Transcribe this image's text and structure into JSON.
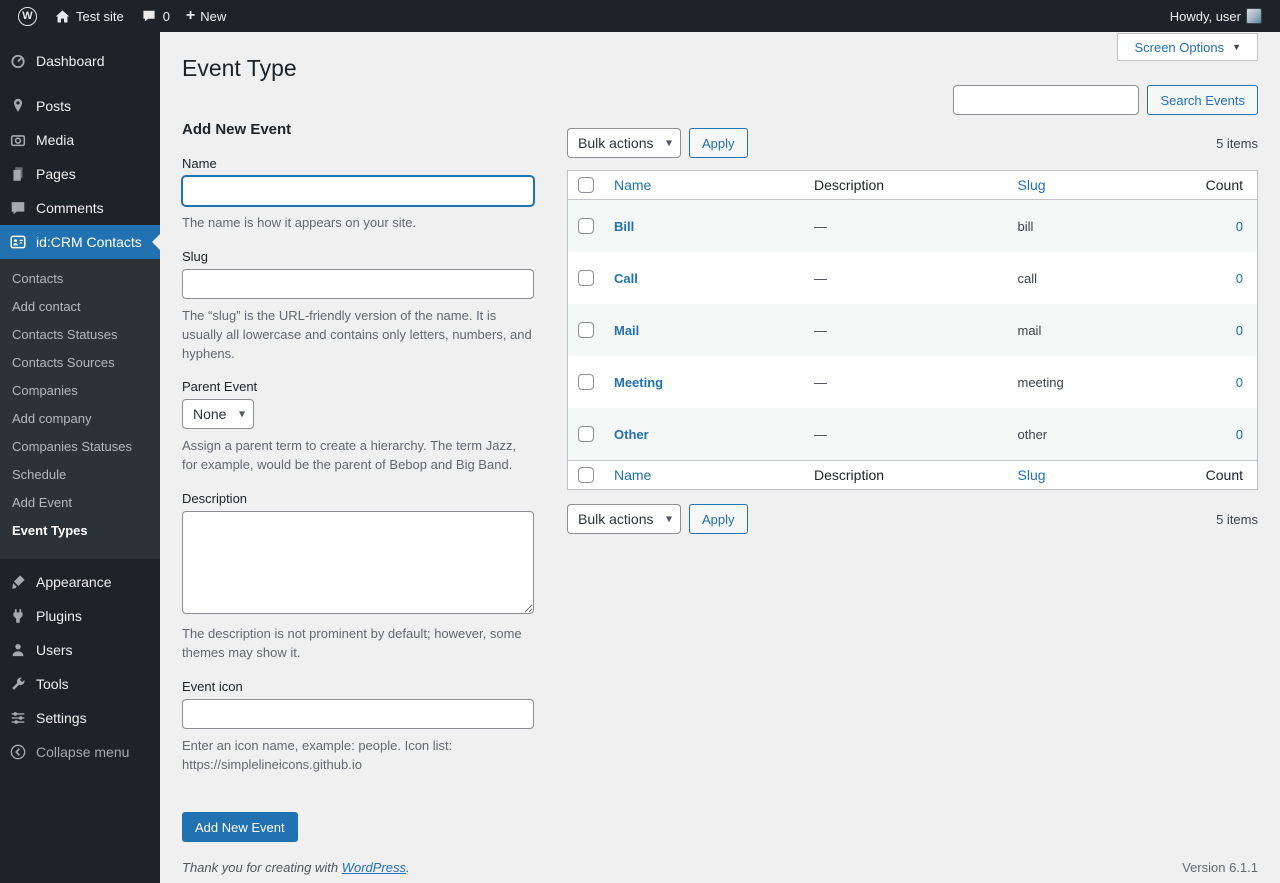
{
  "icons": {
    "chevron_down": "▾",
    "triangle_down": "▼",
    "plus": "+",
    "wp_letter": "W"
  },
  "colors": {
    "accent": "#2271b1",
    "sidebar_bg": "#1d2327",
    "content_bg": "#f0f0f1"
  },
  "admin_bar": {
    "site_name": "Test site",
    "comments_count": "0",
    "new_label": "New",
    "howdy": "Howdy, user"
  },
  "sidebar": {
    "items": [
      {
        "label": "Dashboard"
      },
      {
        "label": "Posts"
      },
      {
        "label": "Media"
      },
      {
        "label": "Pages"
      },
      {
        "label": "Comments"
      },
      {
        "label": "id:CRM Contacts"
      },
      {
        "label": "Appearance"
      },
      {
        "label": "Plugins"
      },
      {
        "label": "Users"
      },
      {
        "label": "Tools"
      },
      {
        "label": "Settings"
      },
      {
        "label": "Collapse menu"
      }
    ],
    "submenu": [
      {
        "label": "Contacts"
      },
      {
        "label": "Add contact"
      },
      {
        "label": "Contacts Statuses"
      },
      {
        "label": "Contacts Sources"
      },
      {
        "label": "Companies"
      },
      {
        "label": "Add company"
      },
      {
        "label": "Companies Statuses"
      },
      {
        "label": "Schedule"
      },
      {
        "label": "Add Event"
      },
      {
        "label": "Event Types"
      }
    ]
  },
  "page": {
    "title": "Event Type",
    "screen_options_label": "Screen Options",
    "search_value": "",
    "search_button": "Search Events"
  },
  "form": {
    "heading": "Add New Event",
    "name_label": "Name",
    "name_value": "",
    "name_help": "The name is how it appears on your site.",
    "slug_label": "Slug",
    "slug_value": "",
    "slug_help": "The “slug” is the URL-friendly version of the name. It is usually all lowercase and contains only letters, numbers, and hyphens.",
    "parent_label": "Parent Event",
    "parent_value": "None",
    "parent_help": "Assign a parent term to create a hierarchy. The term Jazz, for example, would be the parent of Bebop and Big Band.",
    "description_label": "Description",
    "description_value": "",
    "description_help": "The description is not prominent by default; however, some themes may show it.",
    "icon_label": "Event icon",
    "icon_value": "",
    "icon_help": "Enter an icon name, example: people. Icon list: https://simplelineicons.github.io",
    "submit_label": "Add New Event"
  },
  "list": {
    "bulk_actions": "Bulk actions",
    "apply": "Apply",
    "items_count": "5 items",
    "columns": {
      "name": "Name",
      "description": "Description",
      "slug": "Slug",
      "count": "Count"
    },
    "rows": [
      {
        "name": "Bill",
        "description": "—",
        "slug": "bill",
        "count": "0"
      },
      {
        "name": "Call",
        "description": "—",
        "slug": "call",
        "count": "0"
      },
      {
        "name": "Mail",
        "description": "—",
        "slug": "mail",
        "count": "0"
      },
      {
        "name": "Meeting",
        "description": "—",
        "slug": "meeting",
        "count": "0"
      },
      {
        "name": "Other",
        "description": "—",
        "slug": "other",
        "count": "0"
      }
    ]
  },
  "footer": {
    "thanks_prefix": "Thank you for creating with ",
    "wordpress_link": "WordPress",
    "thanks_suffix": ".",
    "version": "Version 6.1.1"
  }
}
